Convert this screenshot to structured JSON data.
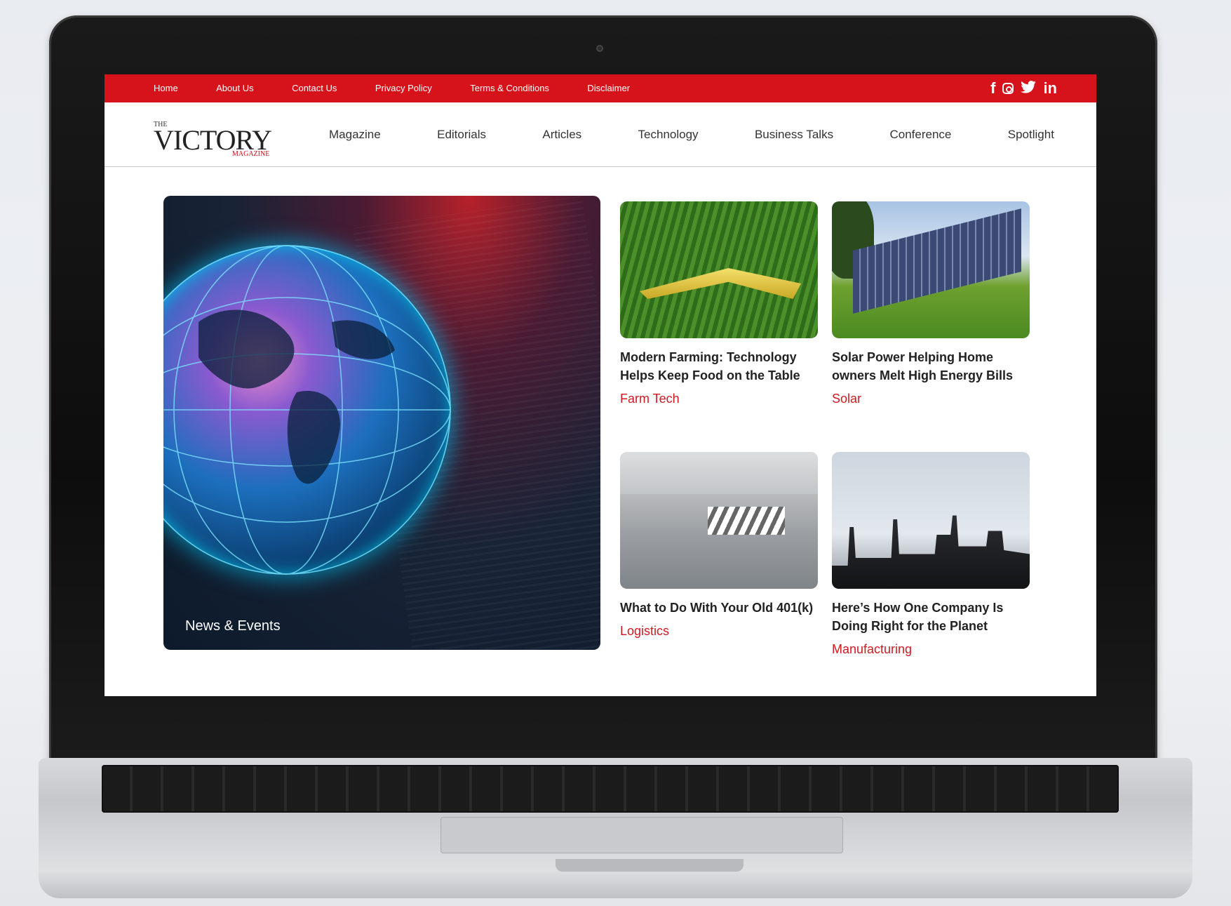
{
  "topbar": {
    "links": [
      "Home",
      "About Us",
      "Contact Us",
      "Privacy Policy",
      "Terms & Conditions",
      "Disclaimer"
    ],
    "social_icons": [
      "facebook-icon",
      "instagram-icon",
      "twitter-icon",
      "linkedin-icon"
    ],
    "social_glyphs": {
      "facebook": "f",
      "twitter": "ᵛ",
      "linkedin": "in"
    },
    "color": "#d6121b"
  },
  "logo": {
    "the": "THE",
    "main": "VICTORY",
    "sub": "MAGAZINE"
  },
  "mainnav": [
    "Magazine",
    "Editorials",
    "Articles",
    "Technology",
    "Business Talks",
    "Conference",
    "Spotlight"
  ],
  "hero": {
    "caption": "News & Events"
  },
  "articles": [
    {
      "title": "Modern Farming: Technology Helps Keep Food on the Table",
      "tag": "Farm Tech"
    },
    {
      "title": "Solar Power Helping Home owners Melt High Energy Bills",
      "tag": "Solar"
    },
    {
      "title": "What to Do With Your Old 401(k)",
      "tag": "Logistics"
    },
    {
      "title": "Here’s How One Company Is Doing Right for the Planet",
      "tag": "Manufacturing"
    }
  ],
  "accent_color": "#d01a22"
}
